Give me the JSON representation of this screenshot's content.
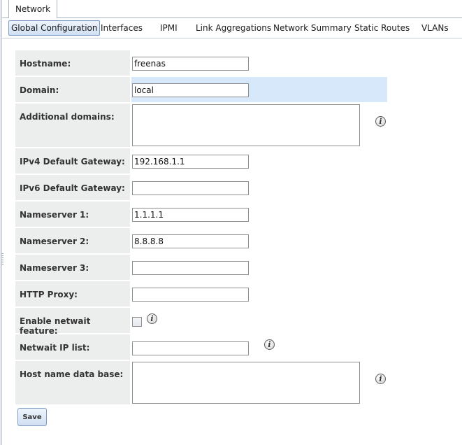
{
  "top_tab": {
    "label": "Network"
  },
  "subtabs": [
    {
      "label": "Global Configuration"
    },
    {
      "label": "Interfaces"
    },
    {
      "label": "IPMI"
    },
    {
      "label": "Link Aggregations"
    },
    {
      "label": "Network Summary"
    },
    {
      "label": "Static Routes"
    },
    {
      "label": "VLANs"
    }
  ],
  "form": {
    "hostname": {
      "label": "Hostname:",
      "value": "freenas"
    },
    "domain": {
      "label": "Domain:",
      "value": "local"
    },
    "additional_domains": {
      "label": "Additional domains:",
      "value": ""
    },
    "ipv4_gateway": {
      "label": "IPv4 Default Gateway:",
      "value": "192.168.1.1"
    },
    "ipv6_gateway": {
      "label": "IPv6 Default Gateway:",
      "value": ""
    },
    "nameserver1": {
      "label": "Nameserver 1:",
      "value": "1.1.1.1"
    },
    "nameserver2": {
      "label": "Nameserver 2:",
      "value": "8.8.8.8"
    },
    "nameserver3": {
      "label": "Nameserver 3:",
      "value": ""
    },
    "http_proxy": {
      "label": "HTTP Proxy:",
      "value": ""
    },
    "netwait": {
      "label": "Enable netwait feature:",
      "checked": false
    },
    "netwait_ip": {
      "label": "Netwait IP list:",
      "value": ""
    },
    "host_db": {
      "label": "Host name data base:",
      "value": ""
    }
  },
  "save_button": {
    "label": "Save"
  },
  "icons": {
    "info": "i"
  },
  "colors": {
    "highlight_row": "#d6e8fa",
    "label_bg": "#eceded",
    "tab_border": "#7b9bc4"
  }
}
